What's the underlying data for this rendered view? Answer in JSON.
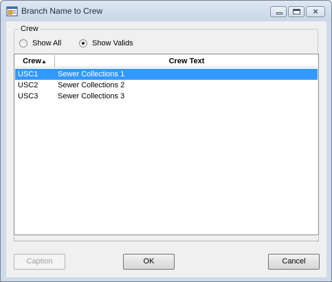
{
  "window": {
    "title": "Branch Name to Crew",
    "controls": {
      "minimize": "minimize",
      "maximize": "maximize",
      "close": "×"
    }
  },
  "filter": {
    "group_label": "Crew",
    "options": [
      {
        "label": "Show All",
        "selected": false
      },
      {
        "label": "Show Valids",
        "selected": true
      }
    ]
  },
  "table": {
    "columns": [
      "Crew",
      "Crew Text"
    ],
    "sort_indicator": "▲",
    "rows": [
      {
        "crew": "USC1",
        "text": "Sewer Collections 1",
        "selected": true
      },
      {
        "crew": "USC2",
        "text": "Sewer Collections 2",
        "selected": false
      },
      {
        "crew": "USC3",
        "text": "Sewer Collections 3",
        "selected": false
      }
    ]
  },
  "buttons": {
    "caption": "Caption",
    "ok": "OK",
    "cancel": "Cancel"
  },
  "colors": {
    "selection": "#3399ff",
    "window_frame": "#cfdbe9",
    "dialog_bg": "#f0f0f0"
  }
}
